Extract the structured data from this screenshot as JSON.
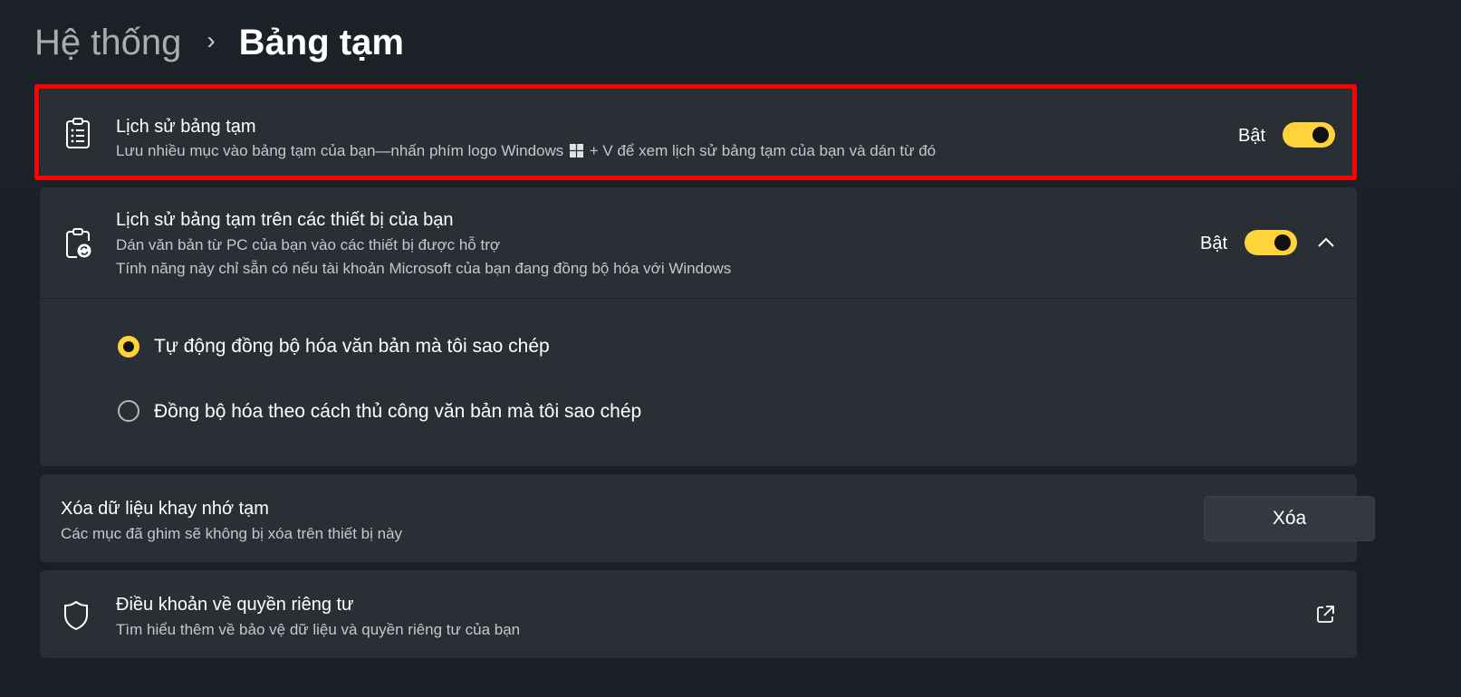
{
  "breadcrumb": {
    "parent": "Hệ thống",
    "separator": "›",
    "current": "Bảng tạm"
  },
  "clipboard_history": {
    "title": "Lịch sử bảng tạm",
    "desc_before": "Lưu nhiều mục vào bảng tạm của bạn—nhấn phím logo Windows",
    "desc_after": "+ V để xem lịch sử bảng tạm của bạn và dán từ đó",
    "toggle_label": "Bật",
    "toggle_on": true,
    "icon": "clipboard-list-icon"
  },
  "cross_device": {
    "title": "Lịch sử bảng tạm trên các thiết bị của bạn",
    "desc_line1": "Dán văn bản từ PC của bạn vào các thiết bị được hỗ trợ",
    "desc_line2": "Tính năng này chỉ sẵn có nếu tài khoản Microsoft của bạn đang đồng bộ hóa với Windows",
    "toggle_label": "Bật",
    "toggle_on": true,
    "expanded": true,
    "icon": "clipboard-sync-icon",
    "options": [
      {
        "label": "Tự động đồng bộ hóa văn bản mà tôi sao chép",
        "selected": true
      },
      {
        "label": "Đồng bộ hóa theo cách thủ công văn bản mà tôi sao chép",
        "selected": false
      }
    ]
  },
  "clear_data": {
    "title": "Xóa dữ liệu khay nhớ tạm",
    "desc": "Các mục đã ghim sẽ không bị xóa trên thiết bị này",
    "button_label": "Xóa"
  },
  "privacy": {
    "title": "Điều khoản về quyền riêng tư",
    "desc": "Tìm hiểu thêm về bảo vệ dữ liệu và quyền riêng tư của bạn",
    "icon": "shield-icon",
    "link_icon": "external-link-icon"
  },
  "colors": {
    "accent": "#ffd43b",
    "highlight": "#ff0000",
    "card": "#2a2f36",
    "background": "#1c2128"
  }
}
